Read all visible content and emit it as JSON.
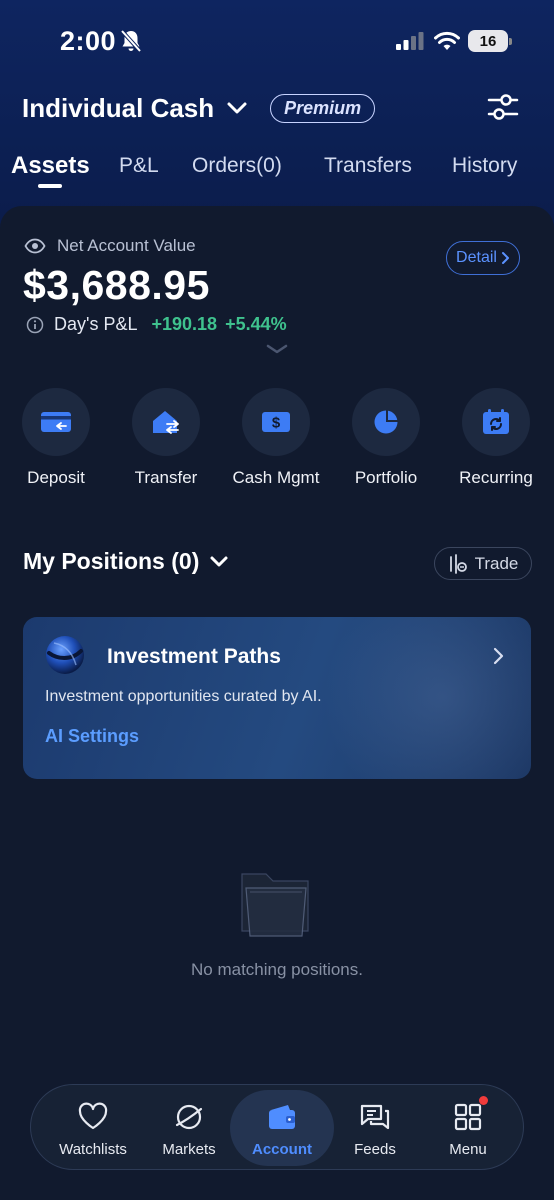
{
  "status_bar": {
    "time": "2:00",
    "battery": "16"
  },
  "header": {
    "account_name": "Individual Cash",
    "badge": "Premium"
  },
  "tabs": [
    {
      "label": "Assets",
      "active": true
    },
    {
      "label": "P&L"
    },
    {
      "label": "Orders(0)"
    },
    {
      "label": "Transfers"
    },
    {
      "label": "History"
    }
  ],
  "summary": {
    "nav_label": "Net Account Value",
    "nav_amount": "$3,688.95",
    "detail_label": "Detail",
    "pl_label": "Day's P&L",
    "pl_value": "+190.18",
    "pl_percent": "+5.44%"
  },
  "actions": [
    {
      "label": "Deposit",
      "icon": "deposit-icon"
    },
    {
      "label": "Transfer",
      "icon": "transfer-icon"
    },
    {
      "label": "Cash Mgmt",
      "icon": "cash-mgmt-icon"
    },
    {
      "label": "Portfolio",
      "icon": "portfolio-icon"
    },
    {
      "label": "Recurring",
      "icon": "recurring-icon"
    }
  ],
  "positions": {
    "title": "My Positions (0)",
    "trade_label": "Trade"
  },
  "investment_paths": {
    "title": "Investment Paths",
    "description": "Investment opportunities curated by AI.",
    "settings_link": "AI Settings"
  },
  "empty_state": {
    "text": "No matching positions."
  },
  "bottom_nav": [
    {
      "label": "Watchlists",
      "icon": "heart-icon"
    },
    {
      "label": "Markets",
      "icon": "planet-icon"
    },
    {
      "label": "Account",
      "icon": "wallet-icon",
      "active": true
    },
    {
      "label": "Feeds",
      "icon": "chat-icon"
    },
    {
      "label": "Menu",
      "icon": "grid-icon",
      "notification": true
    }
  ],
  "colors": {
    "accent": "#4f8dff",
    "positive": "#3fc28e",
    "background": "#111a2e",
    "header": "#0e2560"
  }
}
